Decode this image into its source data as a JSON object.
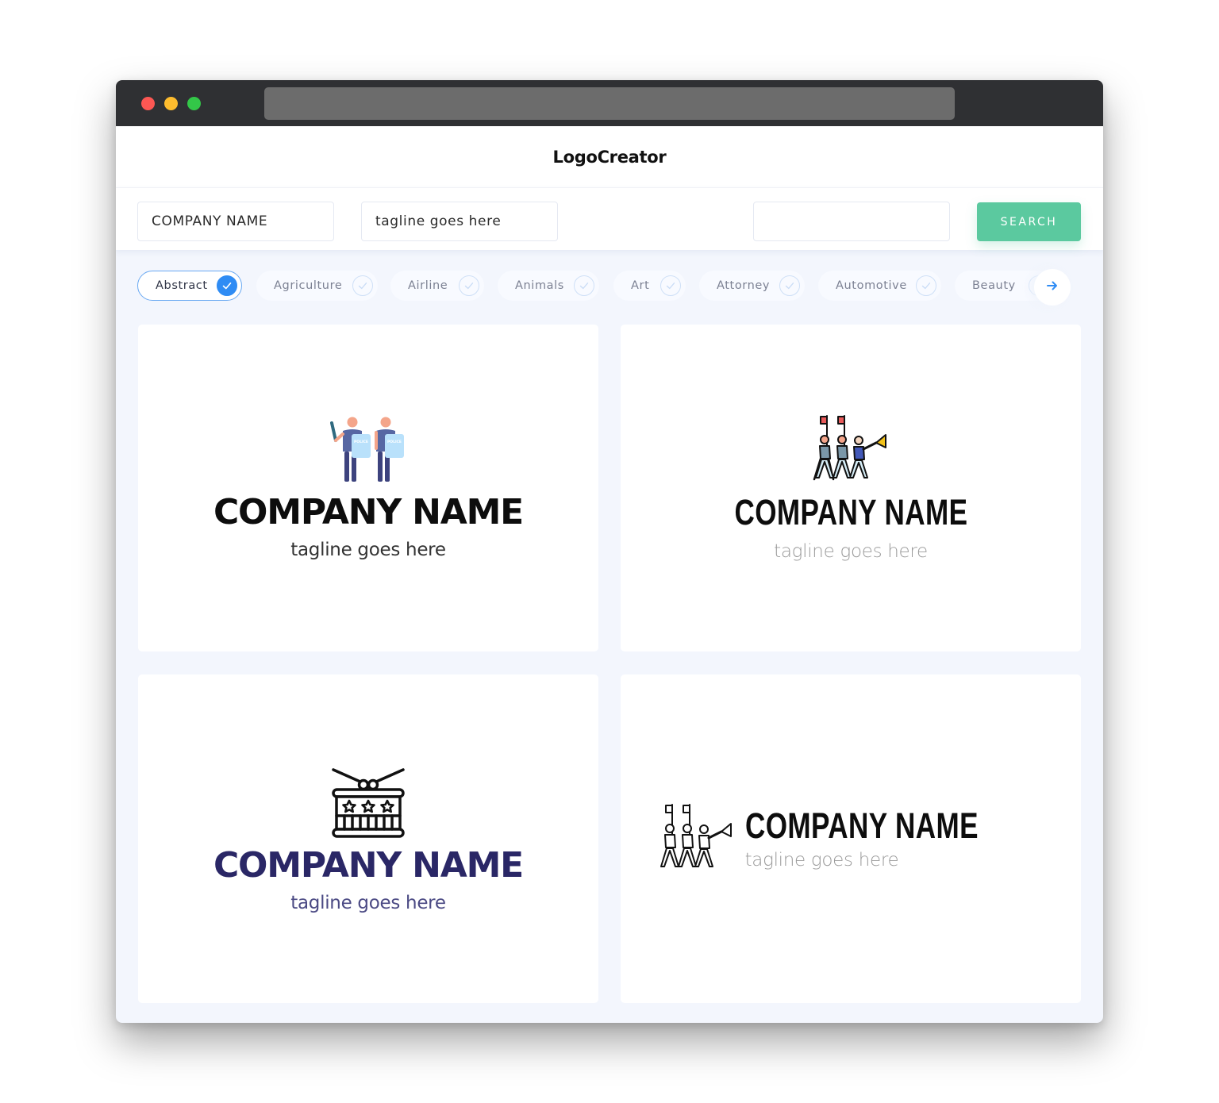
{
  "window": {
    "traffic_lights": [
      "close",
      "minimize",
      "maximize"
    ]
  },
  "header": {
    "brand": "LogoCreator"
  },
  "search": {
    "company_value": "COMPANY NAME",
    "tagline_value": "tagline goes here",
    "extra_value": "",
    "button_label": "SEARCH"
  },
  "categories": [
    {
      "label": "Abstract",
      "selected": true
    },
    {
      "label": "Agriculture",
      "selected": false
    },
    {
      "label": "Airline",
      "selected": false
    },
    {
      "label": "Animals",
      "selected": false
    },
    {
      "label": "Art",
      "selected": false
    },
    {
      "label": "Attorney",
      "selected": false
    },
    {
      "label": "Automotive",
      "selected": false
    },
    {
      "label": "Beauty",
      "selected": false
    }
  ],
  "colors": {
    "accent_green": "#5bc99f",
    "accent_blue": "#2f8cf4",
    "navy": "#2a2766"
  },
  "logos": [
    {
      "icon": "riot-police-icon",
      "company": "COMPANY NAME",
      "tagline": "tagline goes here"
    },
    {
      "icon": "marching-band-color-icon",
      "company": "COMPANY NAME",
      "tagline": "tagline goes here"
    },
    {
      "icon": "snare-drum-icon",
      "company": "COMPANY NAME",
      "tagline": "tagline goes here"
    },
    {
      "icon": "marching-band-outline-icon",
      "company": "COMPANY NAME",
      "tagline": "tagline goes here"
    }
  ]
}
